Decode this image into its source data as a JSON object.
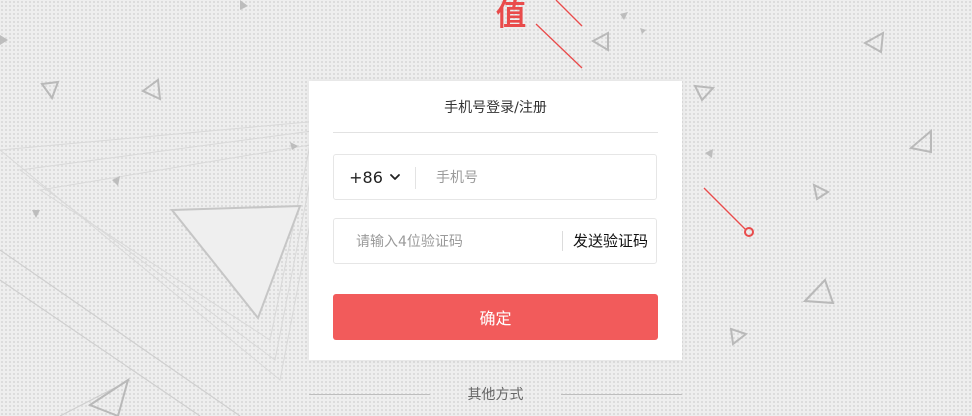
{
  "brand": {
    "partial_char": "值"
  },
  "login": {
    "title": "手机号登录/注册",
    "country_code": "+86",
    "phone_placeholder": "手机号",
    "code_placeholder": "请输入4位验证码",
    "send_code_label": "发送验证码",
    "confirm_label": "确定",
    "other_methods_label": "其他方式"
  },
  "colors": {
    "accent": "#f25b5b",
    "brand_red": "#e94b4b",
    "background": "#eeeeee"
  },
  "icons": {
    "country_dropdown": "chevron-down-icon"
  }
}
